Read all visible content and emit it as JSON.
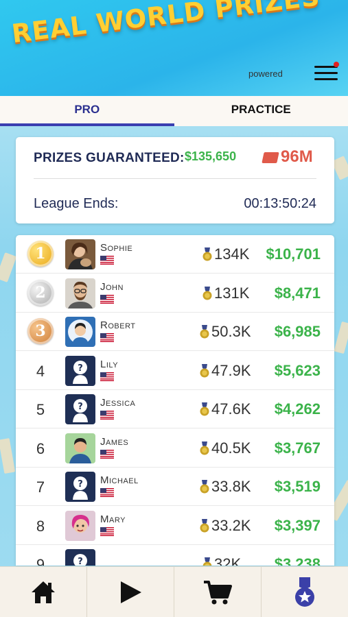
{
  "banner": {
    "title": "REAL WORLD PRIZES",
    "powered": "powered"
  },
  "tabs": [
    {
      "label": "PRO",
      "active": true
    },
    {
      "label": "PRACTICE",
      "active": false
    }
  ],
  "prizes": {
    "label": "PRIZES GUARANTEED:",
    "amount": "$135,650",
    "chips": "96M",
    "league_label": "League Ends:",
    "league_time": "00:13:50:24"
  },
  "leaderboard": [
    {
      "rank": "1",
      "medal": "gold",
      "name": "Sophie",
      "score": "134K",
      "prize": "$10,701",
      "avatar": "photo-female"
    },
    {
      "rank": "2",
      "medal": "silver",
      "name": "John",
      "score": "131K",
      "prize": "$8,471",
      "avatar": "photo-male"
    },
    {
      "rank": "3",
      "medal": "bronze",
      "name": "Robert",
      "score": "50.3K",
      "prize": "$6,985",
      "avatar": "cartoon-male"
    },
    {
      "rank": "4",
      "medal": "",
      "name": "Lily",
      "score": "47.9K",
      "prize": "$5,623",
      "avatar": "placeholder"
    },
    {
      "rank": "5",
      "medal": "",
      "name": "Jessica",
      "score": "47.6K",
      "prize": "$4,262",
      "avatar": "placeholder"
    },
    {
      "rank": "6",
      "medal": "",
      "name": "James",
      "score": "40.5K",
      "prize": "$3,767",
      "avatar": "cartoon-green"
    },
    {
      "rank": "7",
      "medal": "",
      "name": "Michael",
      "score": "33.8K",
      "prize": "$3,519",
      "avatar": "placeholder"
    },
    {
      "rank": "8",
      "medal": "",
      "name": "Mary",
      "score": "33.2K",
      "prize": "$3,397",
      "avatar": "cartoon-pink"
    },
    {
      "rank": "9",
      "medal": "",
      "name": "",
      "score": "32K",
      "prize": "$3,238",
      "avatar": "placeholder"
    }
  ],
  "nav": [
    {
      "icon": "home-icon"
    },
    {
      "icon": "play-icon"
    },
    {
      "icon": "cart-icon"
    },
    {
      "icon": "medal-icon"
    }
  ],
  "colors": {
    "accent": "#3a3fb0",
    "prize_green": "#3bb34a",
    "chips_red": "#e05a4a",
    "banner_yellow": "#ffcf33"
  }
}
